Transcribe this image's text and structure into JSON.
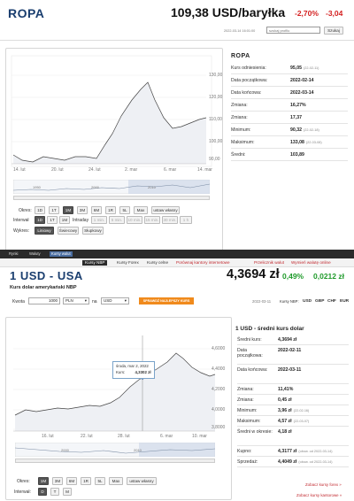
{
  "top": {
    "title": "ROPA",
    "price": "109,38 USD/baryłka",
    "change_pct": "-2,70%",
    "change_abs": "-3,04",
    "timestamp": "2022-03-14 16:01:00",
    "search_placeholder": "szukaj profilu",
    "search_button": "Szukaj"
  },
  "oil_chart": {
    "x_ticks": [
      "14. lut",
      "20. lut",
      "24. lut",
      "2. mar",
      "6. mar",
      "14. mar"
    ],
    "y_ticks": [
      "130,00",
      "120,00",
      "110,00",
      "100,00",
      "90,00"
    ],
    "nav_ticks": [
      "1950",
      "2000",
      "2010"
    ],
    "periods_label": "Okres:",
    "periods": [
      "1D",
      "1T",
      "1M",
      "3M",
      "6M",
      "1R",
      "5L",
      "Max",
      "ustaw własny"
    ],
    "interval_label": "Interwał",
    "intervals": [
      "1D",
      "1T",
      "1M"
    ],
    "intraday_label": "Intraday",
    "intraday": [
      "1 min.",
      "5 min.",
      "10 min.",
      "15 min.",
      "30 min.",
      "1 h"
    ],
    "type_label": "Wykres:",
    "types": [
      "Liniowy",
      "Świecowy",
      "Słupkowy"
    ]
  },
  "oil_stats": {
    "title": "ROPA",
    "rows": [
      {
        "k": "Kurs odniesienia:",
        "v": "95,05",
        "d": "(22-02-11)"
      },
      {
        "k": "Data początkowa:",
        "v": "2022-02-14",
        "d": ""
      },
      {
        "k": "Data końcowa:",
        "v": "2022-03-14",
        "d": ""
      },
      {
        "k": "Zmiana:",
        "v": "16,27%",
        "d": ""
      },
      {
        "k": "Zmiana:",
        "v": "17,37",
        "d": ""
      },
      {
        "k": "Minimum:",
        "v": "90,32",
        "d": "(22-02-18)"
      },
      {
        "k": "Maksimum:",
        "v": "133,08",
        "d": "(22-03-08)"
      },
      {
        "k": "Średni:",
        "v": "103,89",
        "d": ""
      }
    ]
  },
  "nav": {
    "items": [
      "Rynki",
      "Waluty",
      "Kursy walut"
    ],
    "sub": [
      "Kursy NBP",
      "Kursy Forex",
      "Kursy celne",
      "Porównaj kantory internetowe",
      "Przelicznik walut",
      "Wymień walutę online"
    ]
  },
  "usd": {
    "title": "1 USD - USA",
    "subtitle": "Kurs dolar amerykański NBP",
    "price": "4,3694 zł",
    "change_pct": "0,49%",
    "change_abs": "0,0212 zł",
    "calc_label": "Kwota",
    "calc_amount": "1000",
    "calc_from": "PLN",
    "calc_to": "USD",
    "calc_cta": "SPRAWDŹ NAJLEPSZY KURS",
    "date": "2022-03-11",
    "quick_label": "Kursy NBP:",
    "quick": [
      "USD",
      "GBP",
      "CHF",
      "EUR"
    ]
  },
  "usd_chart": {
    "x_ticks": [
      "16. lut",
      "22. lut",
      "28. lut",
      "6. mar",
      "10. mar"
    ],
    "y_ticks": [
      "4,6000",
      "4,4000",
      "4,2000",
      "4,0000",
      "3,8000"
    ],
    "nav_ticks": [
      "2000",
      "2010"
    ],
    "tooltip_date": "środa, mar 2, 2022",
    "tooltip_label": "Kurs:",
    "tooltip_value": "4,3302 zł",
    "periods_label": "Okres:",
    "periods": [
      "1M",
      "3M",
      "6M",
      "1R",
      "5L",
      "Max",
      "ustaw własny"
    ],
    "interval_label": "Interwał:",
    "intervals": [
      "D",
      "T",
      "M"
    ]
  },
  "usd_stats": {
    "title": "1 USD - średni kurs dolar",
    "rows": [
      {
        "k": "Średni kurs:",
        "v": "4,3694 zł",
        "d": ""
      },
      {
        "k": "Data początkowa:",
        "v": "2022-02-11",
        "d": ""
      },
      {
        "k": "Data końcowa:",
        "v": "2022-03-11",
        "d": ""
      },
      {
        "k": "Zmiana:",
        "v": "11,41%",
        "d": ""
      },
      {
        "k": "Zmiana:",
        "v": "0,45 zł",
        "d": ""
      },
      {
        "k": "Minimum:",
        "v": "3,96 zł",
        "d": "(22-02-16)"
      },
      {
        "k": "Maksimum:",
        "v": "4,57 zł",
        "d": "(22-03-07)"
      },
      {
        "k": "Średni w okresie:",
        "v": "4,18 zł",
        "d": ""
      },
      {
        "k": "Kupno:",
        "v": "4,3177 zł",
        "d": "(obow. od 2022-03-14)"
      },
      {
        "k": "Sprzedaż:",
        "v": "4,4049 zł",
        "d": "(obow. od 2022-03-14)"
      }
    ],
    "link1": "Zobacz kursy forex »",
    "link2": "Zobacz kursy kantorowe »"
  }
}
